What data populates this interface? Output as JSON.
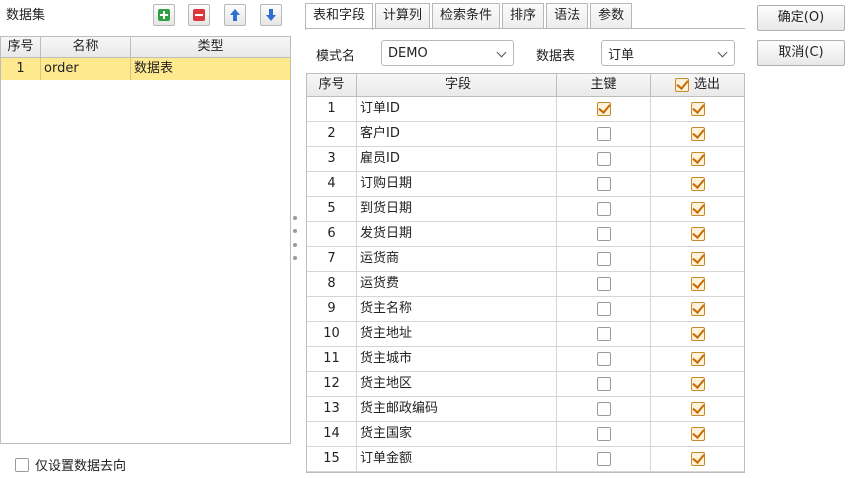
{
  "left": {
    "title": "数据集",
    "toolbar": {
      "add_icon": "plus-icon",
      "delete_icon": "minus-icon",
      "up_icon": "arrow-up-icon",
      "down_icon": "arrow-down-icon"
    },
    "columns": [
      "序号",
      "名称",
      "类型"
    ],
    "rows": [
      {
        "seq": "1",
        "name": "order",
        "type": "数据表"
      }
    ],
    "only_set_label": "仅设置数据去向",
    "only_set_checked": false
  },
  "tabs": [
    "表和字段",
    "计算列",
    "检索条件",
    "排序",
    "语法",
    "参数"
  ],
  "active_tab": 0,
  "mode": {
    "label": "模式名",
    "value": "DEMO"
  },
  "table": {
    "label": "数据表",
    "value": "订单"
  },
  "grid": {
    "columns": {
      "seq": "序号",
      "field": "字段",
      "pk": "主键",
      "sel": "选出"
    },
    "select_all_checked": true,
    "rows": [
      {
        "seq": "1",
        "field": "订单ID",
        "pk": true,
        "sel": true
      },
      {
        "seq": "2",
        "field": "客户ID",
        "pk": false,
        "sel": true
      },
      {
        "seq": "3",
        "field": "雇员ID",
        "pk": false,
        "sel": true
      },
      {
        "seq": "4",
        "field": "订购日期",
        "pk": false,
        "sel": true
      },
      {
        "seq": "5",
        "field": "到货日期",
        "pk": false,
        "sel": true
      },
      {
        "seq": "6",
        "field": "发货日期",
        "pk": false,
        "sel": true
      },
      {
        "seq": "7",
        "field": "运货商",
        "pk": false,
        "sel": true
      },
      {
        "seq": "8",
        "field": "运货费",
        "pk": false,
        "sel": true
      },
      {
        "seq": "9",
        "field": "货主名称",
        "pk": false,
        "sel": true
      },
      {
        "seq": "10",
        "field": "货主地址",
        "pk": false,
        "sel": true
      },
      {
        "seq": "11",
        "field": "货主城市",
        "pk": false,
        "sel": true
      },
      {
        "seq": "12",
        "field": "货主地区",
        "pk": false,
        "sel": true
      },
      {
        "seq": "13",
        "field": "货主邮政编码",
        "pk": false,
        "sel": true
      },
      {
        "seq": "14",
        "field": "货主国家",
        "pk": false,
        "sel": true
      },
      {
        "seq": "15",
        "field": "订单金额",
        "pk": false,
        "sel": true
      }
    ]
  },
  "buttons": {
    "ok": "确定(O)",
    "cancel": "取消(C)"
  },
  "colors": {
    "selected_row": "#ffe98f",
    "check_mark": "#c86a00",
    "add_green": "#2ea043",
    "delete_red": "#d9363e",
    "arrow_blue": "#2f6fd1"
  }
}
